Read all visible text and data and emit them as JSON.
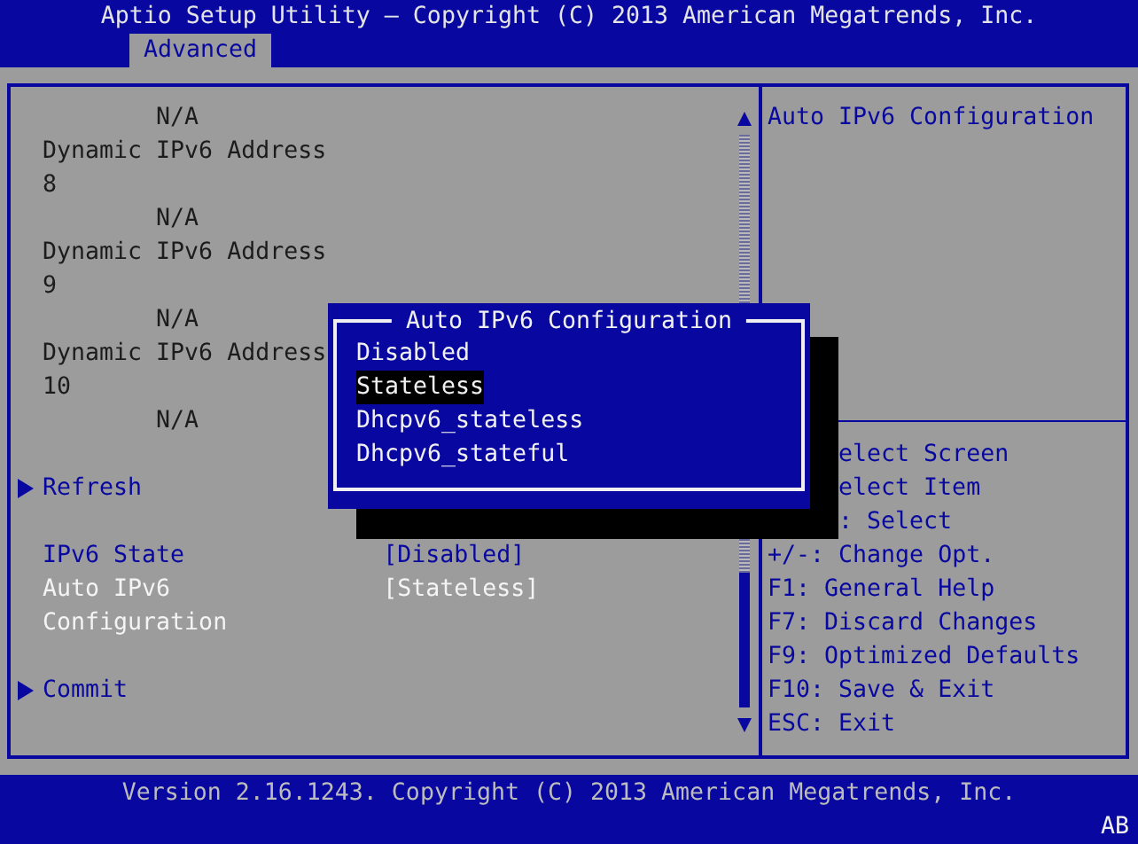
{
  "window": {
    "title": "Aptio Setup Utility – Copyright (C) 2013 American Megatrends, Inc."
  },
  "tabs": [
    {
      "label": "Advanced",
      "selected": true
    }
  ],
  "info": [
    {
      "kind": "value",
      "text": "N/A"
    },
    {
      "kind": "label",
      "text": "Dynamic IPv6 Address 8"
    },
    {
      "kind": "value",
      "text": "N/A"
    },
    {
      "kind": "label",
      "text": "Dynamic IPv6 Address 9"
    },
    {
      "kind": "value",
      "text": "N/A"
    },
    {
      "kind": "label",
      "text": "Dynamic IPv6 Address 10"
    },
    {
      "kind": "value",
      "text": "N/A"
    }
  ],
  "refresh": {
    "label": "Refresh"
  },
  "settings": [
    {
      "label": "IPv6 State",
      "value": "[Disabled]",
      "selected": false
    },
    {
      "label": "Auto IPv6 Configuration",
      "value": "[Stateless]",
      "selected": true
    }
  ],
  "commit": {
    "label": "Commit"
  },
  "help": {
    "title": "Auto IPv6 Configuration",
    "keys": [
      {
        "text": "elect Screen",
        "obscured": true
      },
      {
        "text": "elect Item",
        "obscured": true
      },
      {
        "text": ": Select",
        "obscured": true
      },
      {
        "text": "+/-: Change Opt.",
        "obscured": false
      },
      {
        "text": "F1: General Help",
        "obscured": false
      },
      {
        "text": "F7: Discard Changes",
        "obscured": false
      },
      {
        "text": "F9: Optimized Defaults",
        "obscured": false
      },
      {
        "text": "F10: Save & Exit",
        "obscured": false
      },
      {
        "text": "ESC: Exit",
        "obscured": false
      }
    ]
  },
  "popup": {
    "title": "Auto IPv6 Configuration",
    "options": [
      {
        "label": "Disabled",
        "selected": false
      },
      {
        "label": "Stateless",
        "selected": true
      },
      {
        "label": "Dhcpv6_stateless",
        "selected": false
      },
      {
        "label": "Dhcpv6_stateful",
        "selected": false
      }
    ]
  },
  "status_bar": {
    "text": "Version 2.16.1243. Copyright (C) 2013 American Megatrends, Inc.",
    "indicator": "AB"
  }
}
